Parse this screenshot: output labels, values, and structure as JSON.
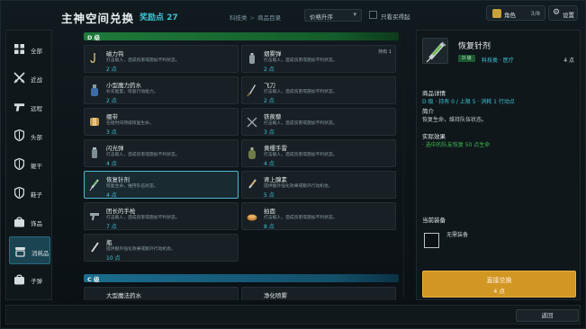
{
  "header": {
    "title": "主神空间兑换",
    "points": "奖励点 27",
    "breadcrumb": [
      "科技类",
      "商品目录"
    ],
    "breadcrumb_sep": ">",
    "sort": "价格升序",
    "only_affordable": "只看买得起",
    "character_label": "角色",
    "character_count": "3/8",
    "settings_label": "设置"
  },
  "sidebar": {
    "items": [
      {
        "label": "全部",
        "icon": "grid-icon"
      },
      {
        "label": "近战",
        "icon": "crossed-swords-icon"
      },
      {
        "label": "远程",
        "icon": "pistol-icon"
      },
      {
        "label": "头部",
        "icon": "shield-icon"
      },
      {
        "label": "躯干",
        "icon": "shield-icon"
      },
      {
        "label": "鞋子",
        "icon": "shield-icon"
      },
      {
        "label": "饰品",
        "icon": "bag-icon"
      },
      {
        "label": "消耗品",
        "icon": "potion-icon"
      },
      {
        "label": "子弹",
        "icon": "bag-icon"
      }
    ],
    "active": 7
  },
  "list": {
    "grade_d": "D 级",
    "grade_c": "C 级",
    "items": [
      {
        "name": "磁力钩",
        "desc": "打击敌人，造成伤害或施加不利状态。",
        "price": "2 点",
        "stock": ""
      },
      {
        "name": "烟雾弹",
        "desc": "打击敌人，造成伤害或施加不利状态。",
        "price": "2 点",
        "stock": "持有 1"
      },
      {
        "name": "小型魔力药水",
        "desc": "补充能量，恢复行动能力。",
        "price": "2 点",
        "stock": ""
      },
      {
        "name": "飞刀",
        "desc": "打击敌人，造成伤害或施加不利状态。",
        "price": "2 点",
        "stock": ""
      },
      {
        "name": "绷带",
        "desc": "在短时间持续恢复生命。",
        "price": "3 点",
        "stock": ""
      },
      {
        "name": "铁蒺藜",
        "desc": "打击敌人，造成伤害或施加不利状态。",
        "price": "3 点",
        "stock": ""
      },
      {
        "name": "闪光弹",
        "desc": "打击敌人，造成伤害或施加不利状态。",
        "price": "4 点",
        "stock": ""
      },
      {
        "name": "黄缨手雷",
        "desc": "打击敌人，造成伤害或施加不利状态。",
        "price": "4 点",
        "stock": ""
      },
      {
        "name": "恢复针剂",
        "desc": "恢复生命，维持队伍状态。",
        "price": "4 点",
        "stock": ""
      },
      {
        "name": "肾上腺素",
        "desc": "提供额外强化效果或额外行动机会。",
        "price": "5 点",
        "stock": ""
      },
      {
        "name": "团长的手枪",
        "desc": "打击敌人，造成伤害或施加不利状态。",
        "price": "7 点",
        "stock": ""
      },
      {
        "name": "拍面",
        "desc": "打击敌人，造成伤害或施加不利状态。",
        "price": "8 点",
        "stock": ""
      },
      {
        "name": "瓶",
        "desc": "提供额外强化效果或额外行动机会。",
        "price": "10 点",
        "stock": ""
      },
      {
        "name": "大型魔法药水",
        "desc": "",
        "price": "",
        "stock": ""
      },
      {
        "name": "净化喷雾",
        "desc": "",
        "price": "",
        "stock": ""
      }
    ]
  },
  "detail": {
    "name": "恢复针剂",
    "grade": "D 级",
    "category": "科技类 · 医疗",
    "price": "4 点",
    "details_title": "商品详情",
    "details_line": "D 级 · 持有 0 / 上限 5 · 消耗 1 行动点",
    "intro_title": "简介",
    "intro_text": "恢复生命，维持队伍状态。",
    "effect_title": "实际效果",
    "effect_text": "· 选中的队友恢复 50 点生命",
    "equip_title": "当前装备",
    "equip_none": "无需装备",
    "buy_label": "直接兑换",
    "buy_price": "4 点"
  },
  "footer": {
    "back": "返回"
  },
  "colors": {
    "accent_cyan": "#3fc3d4",
    "grade_d_green": "#1f7a3a",
    "grade_c_blue": "#1a6c8f",
    "buy_orange": "#d29623",
    "sidebar_active": "#1b4452"
  }
}
